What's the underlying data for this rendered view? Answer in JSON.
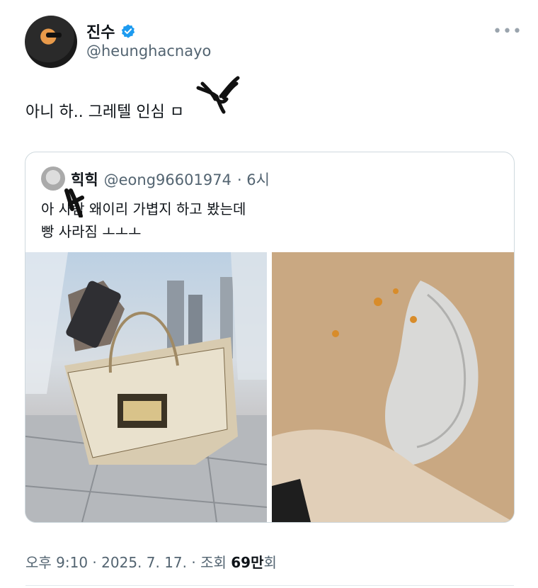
{
  "author": {
    "display_name": "진수",
    "handle": "@heunghacnayo",
    "verified_icon": "verified-badge-icon",
    "accent": "#1d9bf0"
  },
  "tweet": {
    "text": "아니 하.. 그레텔 인심 ㅁ"
  },
  "quoted": {
    "name": "힉힉",
    "handle": "@eong96601974",
    "time": "· 6시",
    "line1": "아 사람 왜이리 가볍지 하고 봤는데",
    "line2": "빵 사라짐 ㅗㅗㅗ"
  },
  "footer": {
    "time": "오후 9:10 · 2025. 7. 17. · 조회 ",
    "views": "69만",
    "views_suffix": "회"
  },
  "more_label": "•••"
}
